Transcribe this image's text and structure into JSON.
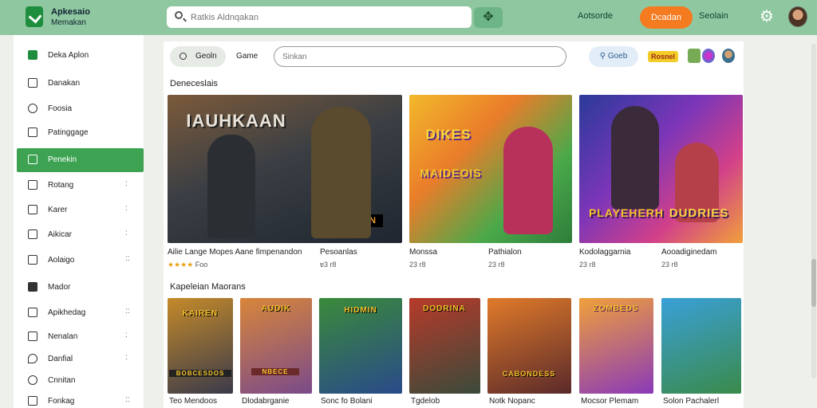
{
  "topbar": {
    "brand_line1": "Apkesaio",
    "brand_line2": "Memakan",
    "search_placeholder": "Ratkis Aldnqakan",
    "gamepad_icon": "gamepad-icon",
    "link": "Aotsorde",
    "cta_label": "Dcadan",
    "signin_label": "Seolain"
  },
  "sidebar": {
    "items": [
      {
        "label": "Deka Aplon",
        "icon": "app-logo-icon"
      },
      {
        "label": "Danakan",
        "icon": "cube-icon"
      },
      {
        "label": "Foosia",
        "icon": "person-icon"
      },
      {
        "label": "Patinggage",
        "icon": "package-icon"
      },
      {
        "label": "Penekin",
        "icon": "gamepad-icon",
        "active": true
      },
      {
        "label": "Rotang",
        "icon": "square-icon",
        "more": ":"
      },
      {
        "label": "Karer",
        "icon": "bag-icon",
        "more": ":"
      },
      {
        "label": "Aikicar",
        "icon": "flag-icon",
        "more": ":"
      },
      {
        "label": "Aolaigo",
        "icon": "image-icon",
        "more": "::"
      },
      {
        "label": "Mador",
        "icon": "home-icon"
      },
      {
        "label": "Apikhedag",
        "icon": "list-icon",
        "more": "::"
      },
      {
        "label": "Nenalan",
        "icon": "square-icon",
        "more": ":"
      },
      {
        "label": "Danfial",
        "icon": "pin-icon",
        "more": ":"
      },
      {
        "label": "Cnnitan",
        "icon": "check-icon"
      },
      {
        "label": "Fonkag",
        "icon": "grid-icon",
        "more": "::"
      }
    ]
  },
  "filters": {
    "home_label": "Geoln",
    "game_label": "Game",
    "search_placeholder": "Sinkan",
    "sort_label": "Goeb",
    "badge_label": "Rosnel"
  },
  "sections": {
    "featured_title": "Deneceslais",
    "second_title": "Kapeleian Maorans"
  },
  "featured": [
    {
      "name": "Ailie Lange Mopes Aane fimpenandon",
      "meta": "Foo",
      "stars": "★★★★",
      "art": "IAUHKAAN",
      "sub": "IAIKAN"
    },
    {
      "name": "Pesoanlas",
      "meta": "ɐ3 r8",
      "art": "",
      "sub": ""
    },
    {
      "name": "Monssa",
      "meta": "23 r8",
      "art": "DIKES",
      "sub": "MAIDEOIS"
    },
    {
      "name": "Pathialon",
      "meta": "23 r8",
      "art": "",
      "sub": ""
    },
    {
      "name": "Kodolaggarnia",
      "meta": "23 r8",
      "art": "PLAYEHERH",
      "sub": "DUDRIES"
    },
    {
      "name": "Aooadiginedam",
      "meta": "23 r8",
      "art": "",
      "sub": ""
    }
  ],
  "grid": [
    {
      "name": "Teo Mendoos",
      "art": "KAIREN",
      "sub": "BOBCESDOS"
    },
    {
      "name": "Dlodabrganie",
      "art": "AUDIK",
      "sub": "NBECE"
    },
    {
      "name": "Sonc fo Bolani",
      "art": "HIDMIN",
      "sub": ""
    },
    {
      "name": "Tgdelob",
      "art": "DODRINA",
      "sub": ""
    },
    {
      "name": "Notk Nopanc",
      "art": "",
      "sub": "CABONDESS"
    },
    {
      "name": "Mocsor Plemam",
      "art": "ZOMBEDS",
      "sub": ""
    },
    {
      "name": "Solon Pachalerl",
      "art": "",
      "sub": ""
    }
  ]
}
